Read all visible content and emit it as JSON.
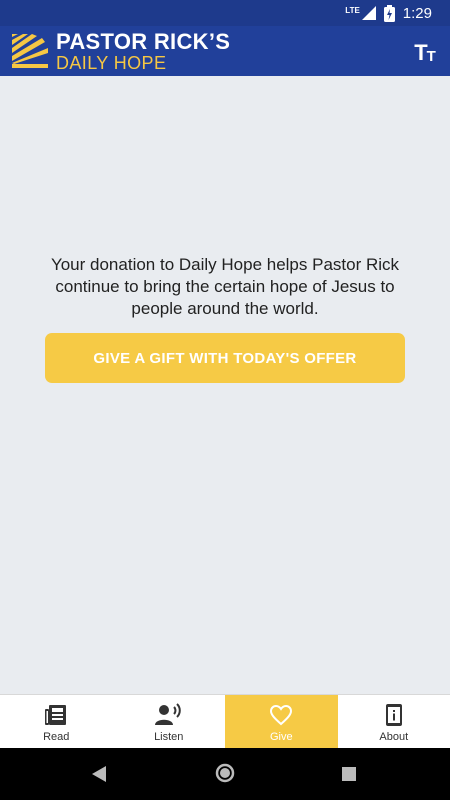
{
  "status_bar": {
    "network": "LTE",
    "time": "1:29"
  },
  "app_bar": {
    "logo_title": "PASTOR RICK’S",
    "logo_subtitle": "DAILY HOPE",
    "text_size_button": {
      "big": "T",
      "small": "T"
    }
  },
  "give": {
    "message": "Your donation to Daily Hope helps Pastor Rick continue to bring the certain hope of Jesus to people around the world.",
    "cta_label": "GIVE A GIFT WITH TODAY'S OFFER"
  },
  "bottom_nav": {
    "items": [
      {
        "label": "Read",
        "icon": "newspaper-icon"
      },
      {
        "label": "Listen",
        "icon": "speaker-person-icon"
      },
      {
        "label": "Give",
        "icon": "heart-icon",
        "active": true
      },
      {
        "label": "About",
        "icon": "phone-info-icon"
      }
    ]
  },
  "colors": {
    "status_bar": "#1e3a8c",
    "app_bar": "#21409a",
    "accent": "#f6ca45",
    "background": "#e9ecf0"
  }
}
